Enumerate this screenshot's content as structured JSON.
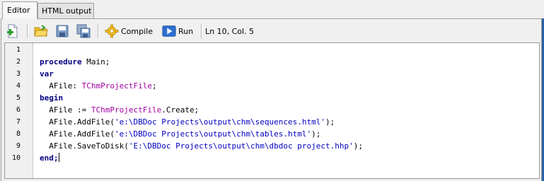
{
  "tabs": {
    "editor": "Editor",
    "html_output": "HTML output"
  },
  "toolbar": {
    "compile_label": "Compile",
    "run_label": "Run",
    "status": "Ln 10, Col. 5"
  },
  "editor": {
    "line_numbers": [
      "1",
      "2",
      "3",
      "4",
      "5",
      "6",
      "7",
      "8",
      "9",
      "10"
    ],
    "code": {
      "l2_kw": "procedure",
      "l2_rest": " Main;",
      "l3_kw": "var",
      "l4_a": "  AFile: ",
      "l4_type": "TChmProjectFile",
      "l4_b": ";",
      "l5_kw": "begin",
      "l6_a": "  AFile := ",
      "l6_type": "TChmProjectFile",
      "l6_b": ".Create;",
      "l7_a": "  AFile.AddFile(",
      "l7_str": "'e:\\DBDoc Projects\\output\\chm\\sequences.html'",
      "l7_b": ");",
      "l8_a": "  AFile.AddFile(",
      "l8_str": "'e:\\DBDoc Projects\\output\\chm\\tables.html'",
      "l8_b": ");",
      "l9_a": "  AFile.SaveToDisk(",
      "l9_str": "'E:\\DBDoc Projects\\output\\chm\\dbdoc project.hhp'",
      "l9_b": ");",
      "l10_kw": "end;"
    }
  },
  "colors": {
    "keyword": "#000080",
    "type": "#a000a0",
    "string": "#0000c0"
  }
}
